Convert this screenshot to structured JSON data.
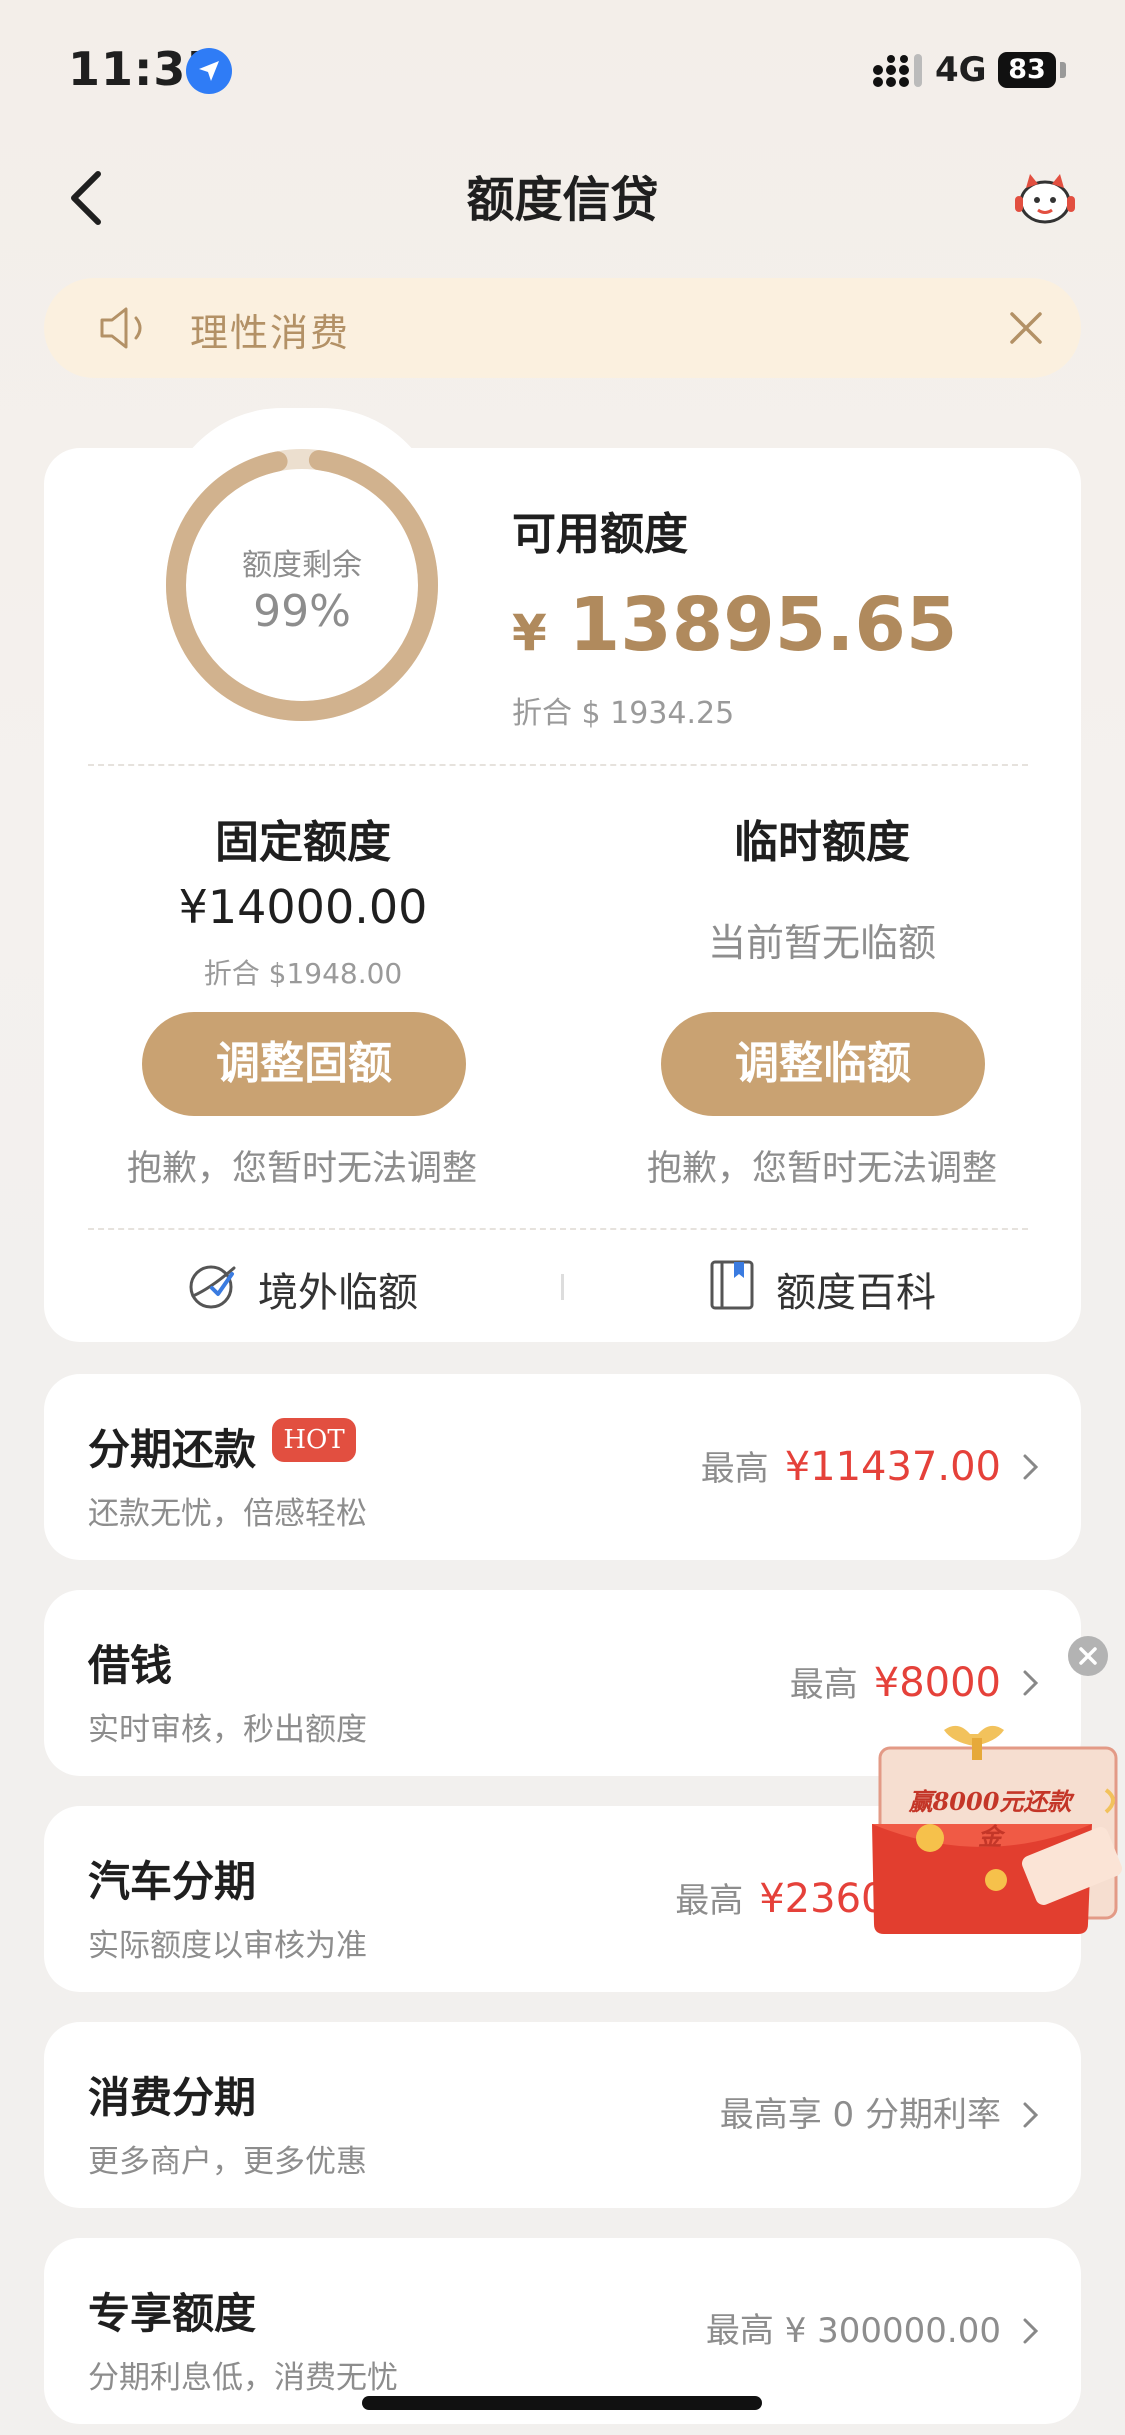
{
  "status_bar": {
    "time": "11:35",
    "network": "4G",
    "battery": "83"
  },
  "header": {
    "title": "额度信贷"
  },
  "notice": {
    "text": "理性消费"
  },
  "credit": {
    "ring_label": "额度剩余",
    "ring_percent": "99%",
    "ring_fraction": 0.99,
    "available_label": "可用额度",
    "available_currency": "¥",
    "available_amount": "13895.65",
    "available_converted": "折合 $ 1934.25"
  },
  "fixed": {
    "title": "固定额度",
    "amount": "¥14000.00",
    "converted": "折合 $1948.00",
    "button": "调整固额",
    "note": "抱歉，您暂时无法调整"
  },
  "temporary": {
    "title": "临时额度",
    "status": "当前暂无临额",
    "button": "调整临额",
    "note": "抱歉，您暂时无法调整"
  },
  "links": {
    "overseas": "境外临额",
    "wiki": "额度百科"
  },
  "list": [
    {
      "title": "分期还款",
      "badge": "HOT",
      "subtitle": "还款无忧，倍感轻松",
      "prefix": "最高",
      "amount": "¥11437.00"
    },
    {
      "title": "借钱",
      "subtitle": "实时审核，秒出额度",
      "prefix": "最高",
      "amount": "¥8000"
    },
    {
      "title": "汽车分期",
      "subtitle": "实际额度以审核为准",
      "prefix": "最高",
      "amount": "¥236000.00"
    },
    {
      "title": "消费分期",
      "subtitle": "更多商户，更多优惠",
      "prefix": "最高享 0 分期利率",
      "amount": ""
    },
    {
      "title": "专享额度",
      "subtitle": "分期利息低，消费无忧",
      "prefix": "最高 ¥ 300000.00",
      "amount": ""
    }
  ],
  "promo": {
    "text": "赢8000元还款金"
  },
  "colors": {
    "accent": "#c9a272",
    "gold_text": "#b08a5d",
    "red": "#e5413a",
    "notice_bg": "#fbf0df"
  }
}
